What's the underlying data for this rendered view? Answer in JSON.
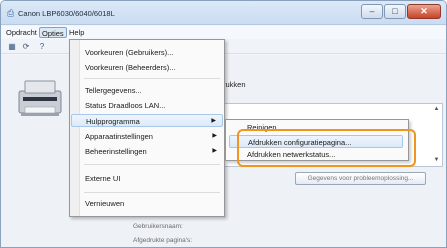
{
  "window": {
    "title": "Canon LBP6030/6040/6018L",
    "controls": {
      "minimize": "–",
      "maximize": "□",
      "close": "✕"
    }
  },
  "menubar": {
    "items": [
      {
        "label": "Opdracht"
      },
      {
        "label": "Opties"
      },
      {
        "label": "Help"
      }
    ]
  },
  "toolbar": {
    "icons": [
      "printer-icon",
      "refresh-icon",
      "help-icon"
    ]
  },
  "main": {
    "printer_label": "rukken",
    "problem_button": "Gegevens voor probleemoplossing...",
    "info_labels": [
      {
        "label": "Gebruikersnaam:"
      },
      {
        "label": "Afgedrukte pagina's:"
      }
    ]
  },
  "dropdown": {
    "items": [
      {
        "label": "Voorkeuren (Gebruikers)..."
      },
      {
        "label": "Voorkeuren (Beheerders)..."
      },
      {
        "label": "Tellergegevens..."
      },
      {
        "label": "Status Draadloos LAN..."
      },
      {
        "label": "Hulpprogramma",
        "submenu": "▶"
      },
      {
        "label": "Apparaatinstellingen",
        "submenu": "▶"
      },
      {
        "label": "Beheerinstellingen",
        "submenu": "▶"
      },
      {
        "label": "Externe UI"
      },
      {
        "label": "Vernieuwen"
      }
    ]
  },
  "submenu": {
    "items": [
      {
        "label": "Reinigen..."
      },
      {
        "label": "Afdrukken configuratiepagina..."
      },
      {
        "label": "Afdrukken netwerkstatus..."
      }
    ]
  },
  "colors": {
    "highlight": "#dbe9f8",
    "callout": "#f0961e",
    "titlebar": "#c9dcf1"
  }
}
